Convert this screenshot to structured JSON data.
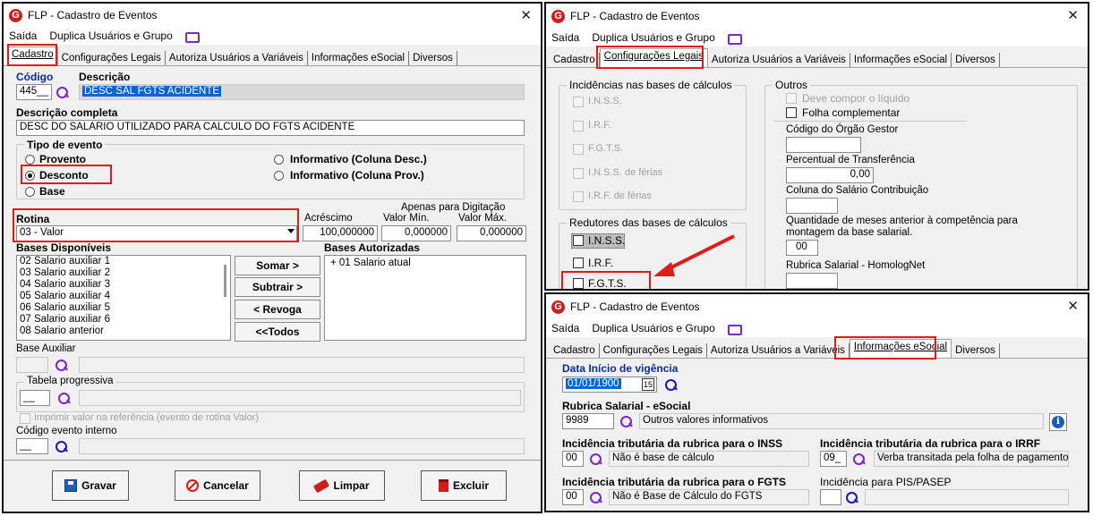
{
  "win1": {
    "title": "FLP - Cadastro de Eventos",
    "menu": [
      "Saída",
      "Duplica Usuários e Grupo"
    ],
    "tabs": [
      "Cadastro",
      "Configurações Legais",
      "Autoriza Usuários a Variáveis",
      "Informações eSocial",
      "Diversos"
    ],
    "codigo_label": "Código",
    "codigo_value": "445__",
    "descricao_label": "Descrição",
    "descricao_value": "DESC SAL FGTS ACIDENTE",
    "desc_completa_label": "Descrição completa",
    "desc_completa_value": "DESC DO SALARIO UTILIZADO PARA CALCULO DO FGTS ACIDENTE",
    "tipo_evento_label": "Tipo de evento",
    "tipo_options": [
      "Provento",
      "Desconto",
      "Base",
      "Informativo (Coluna Desc.)",
      "Informativo (Coluna Prov.)"
    ],
    "tipo_selected": "Desconto",
    "rotina_label": "Rotina",
    "rotina_value": "03 - Valor",
    "acrescimo_label": "Acréscimo",
    "acrescimo_value": "100,000000",
    "apenas_label": "Apenas para Digitação",
    "valor_min_label": "Valor Mín.",
    "valor_min_value": "0,000000",
    "valor_max_label": "Valor Máx.",
    "valor_max_value": "0,000000",
    "bases_disp_label": "Bases Disponíveis",
    "bases_disp": [
      "02 Salario auxiliar 1",
      "03 Salario auxiliar 2",
      "04 Salario auxiliar 3",
      "05 Salario auxiliar 4",
      "06 Salario auxiliar 5",
      "07 Salario auxiliar 6",
      "08 Salario anterior"
    ],
    "bases_aut_label": "Bases Autorizadas",
    "bases_aut": [
      "+ 01 Salario atual"
    ],
    "btn_somar": "Somar >",
    "btn_subtrair": "Subtrair >",
    "btn_revoga": "< Revoga",
    "btn_todos": "<<Todos",
    "base_aux_label": "Base Auxiliar",
    "tabela_prog_label": "Tabela progressiva",
    "imprimir_label": "Imprimir valor na referência (evento de rotina Valor)",
    "cod_interno_label": "Código evento interno",
    "btn_gravar": "Gravar",
    "btn_cancelar": "Cancelar",
    "btn_limpar": "Limpar",
    "btn_excluir": "Excluir"
  },
  "win2": {
    "title": "FLP - Cadastro de Eventos",
    "menu": [
      "Saída",
      "Duplica Usuários e Grupo"
    ],
    "tabs": [
      "Cadastro",
      "Configurações Legais",
      "Autoriza Usuários a Variáveis",
      "Informações eSocial",
      "Diversos"
    ],
    "incid_label": "Incidências nas bases de cálculos",
    "incid_items": [
      "I.N.S.S.",
      "I.R.F.",
      "F.G.T.S.",
      "I.N.S.S. de férias",
      "I.R.F. de férias"
    ],
    "redut_label": "Redutores das bases de cálculos",
    "redut_items": [
      "I.N.S.S.",
      "I.R.F.",
      "F.G.T.S."
    ],
    "outros_label": "Outros",
    "deve_compor": "Deve compor o líquido",
    "folha_compl": "Folha complementar",
    "cod_orgao_label": "Código do Órgão Gestor",
    "perc_transf_label": "Percentual de Transferência",
    "perc_transf_value": "0,00",
    "coluna_sal_label": "Coluna do Salário Contribuição",
    "qtd_meses_label": "Quantidade de meses anterior à competência para montagem da base salarial.",
    "qtd_meses_value": "00",
    "rubrica_homolog_label": "Rubrica Salarial - HomologNet"
  },
  "win3": {
    "title": "FLP - Cadastro de Eventos",
    "menu": [
      "Saída",
      "Duplica Usuários e Grupo"
    ],
    "tabs": [
      "Cadastro",
      "Configurações Legais",
      "Autoriza Usuários a Variáveis",
      "Informações eSocial",
      "Diversos"
    ],
    "data_inicio_label": "Data Início de vigência",
    "data_inicio_value": "01/01/1900",
    "cal_label": "15",
    "rubrica_label": "Rubrica Salarial - eSocial",
    "rubrica_code": "9989",
    "rubrica_desc": "Outros valores informativos",
    "inss_label": "Incidência tributária da rubrica para o INSS",
    "inss_code": "00",
    "inss_desc": "Não é base de cálculo",
    "irrf_label": "Incidência tributária da rubrica para o IRRF",
    "irrf_code": "09_",
    "irrf_desc": "Verba transitada pela folha de pagamento de",
    "fgts_label": "Incidência tributária da rubrica para o FGTS",
    "fgts_code": "00",
    "fgts_desc": "Não é Base de Cálculo do FGTS",
    "pis_label": "Incidência para PIS/PASEP"
  }
}
